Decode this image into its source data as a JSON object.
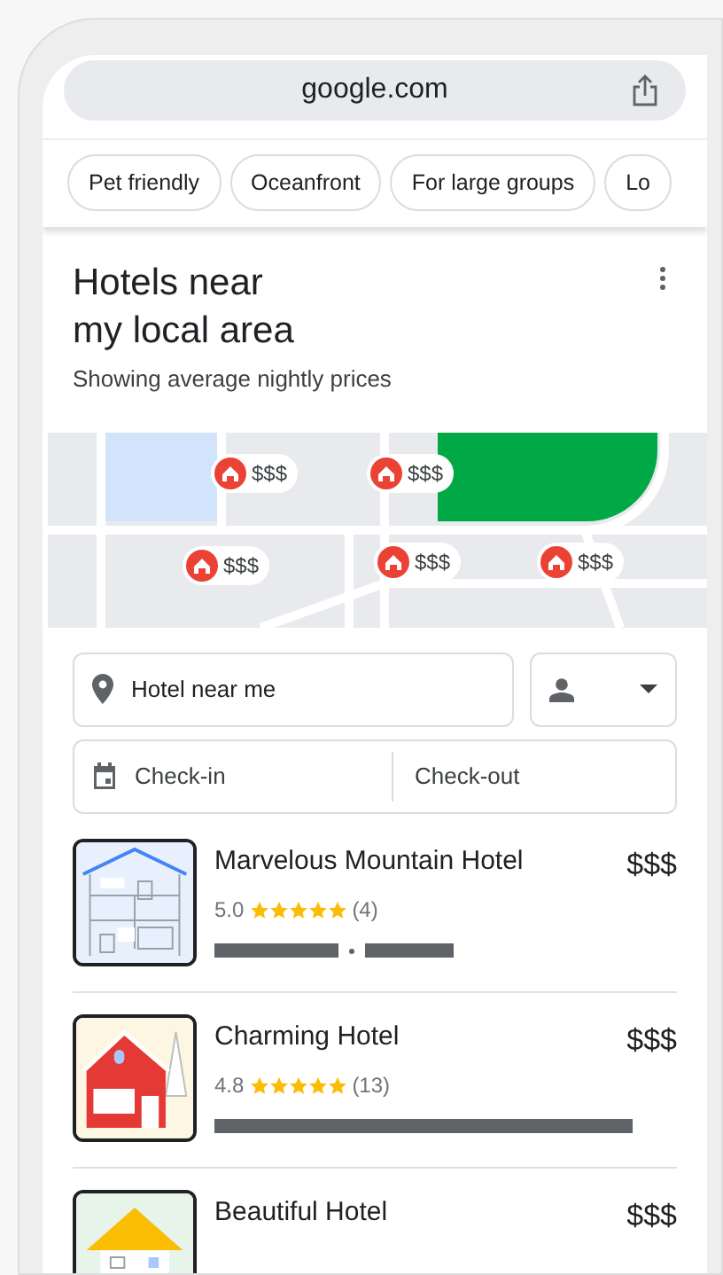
{
  "browser": {
    "address": "google.com"
  },
  "chips": [
    {
      "label": "Pet friendly"
    },
    {
      "label": "Oceanfront"
    },
    {
      "label": "For large groups"
    },
    {
      "label": "Lo"
    }
  ],
  "header": {
    "title_lines": [
      "Hotels near",
      "my local area"
    ],
    "subtitle": "Showing average nightly prices"
  },
  "map": {
    "pins": [
      {
        "price": "$$$"
      },
      {
        "price": "$$$"
      },
      {
        "price": "$$$"
      },
      {
        "price": "$$$"
      },
      {
        "price": "$$$"
      }
    ]
  },
  "search": {
    "location": "Hotel near me",
    "check_in": "Check-in",
    "check_out": "Check-out"
  },
  "hotels": [
    {
      "name": "Marvelous Mountain Hotel",
      "price": "$$$",
      "rating": "5.0",
      "stars": 5,
      "reviews": "(4)"
    },
    {
      "name": "Charming Hotel",
      "price": "$$$",
      "rating": "4.8",
      "stars": 5,
      "reviews": "(13)"
    },
    {
      "name": "Beautiful Hotel",
      "price": "$$$"
    }
  ]
}
